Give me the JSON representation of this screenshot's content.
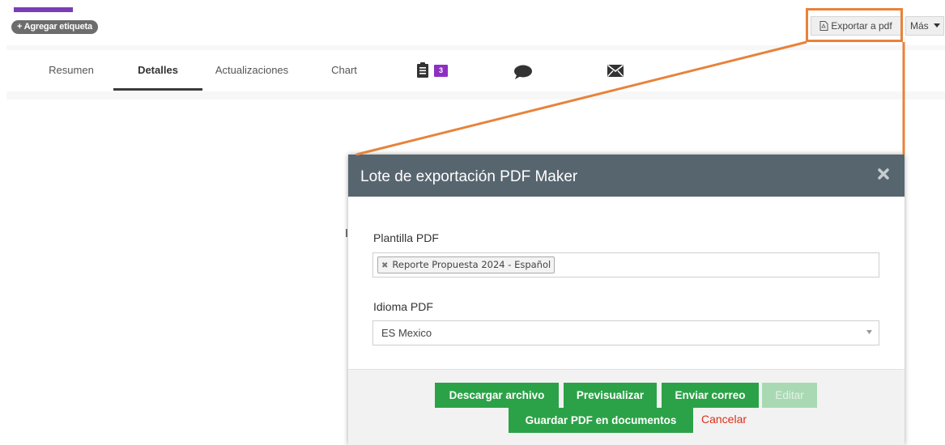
{
  "header": {
    "tag_button_label": "+ Agregar etiqueta",
    "export_label": "Exportar a pdf",
    "more_label": "Más"
  },
  "tabs": [
    {
      "label": "Resumen"
    },
    {
      "label": "Detalles",
      "active": true
    },
    {
      "label": "Actualizaciones"
    },
    {
      "label": "Chart"
    }
  ],
  "icon_tabs": {
    "documents": {
      "icon": "document-list-icon",
      "badge": "3"
    },
    "comments": {
      "icon": "speech-bubble-icon"
    },
    "email": {
      "icon": "envelope-icon"
    }
  },
  "modal": {
    "title": "Lote de exportación PDF Maker",
    "template_label": "Plantilla PDF",
    "template_value": "Reporte Propuesta 2024 - Español",
    "language_label": "Idioma PDF",
    "language_value": "ES Mexico",
    "buttons": {
      "download": "Descargar archivo",
      "preview": "Previsualizar",
      "send": "Enviar correo",
      "edit": "Editar",
      "save": "Guardar PDF en documentos",
      "cancel": "Cancelar"
    }
  },
  "colors": {
    "accent_purple": "#7a3db8",
    "highlight_orange": "#e8823a",
    "modal_header": "#57656f",
    "button_green": "#2ba247",
    "cancel_red": "#d9301b"
  }
}
